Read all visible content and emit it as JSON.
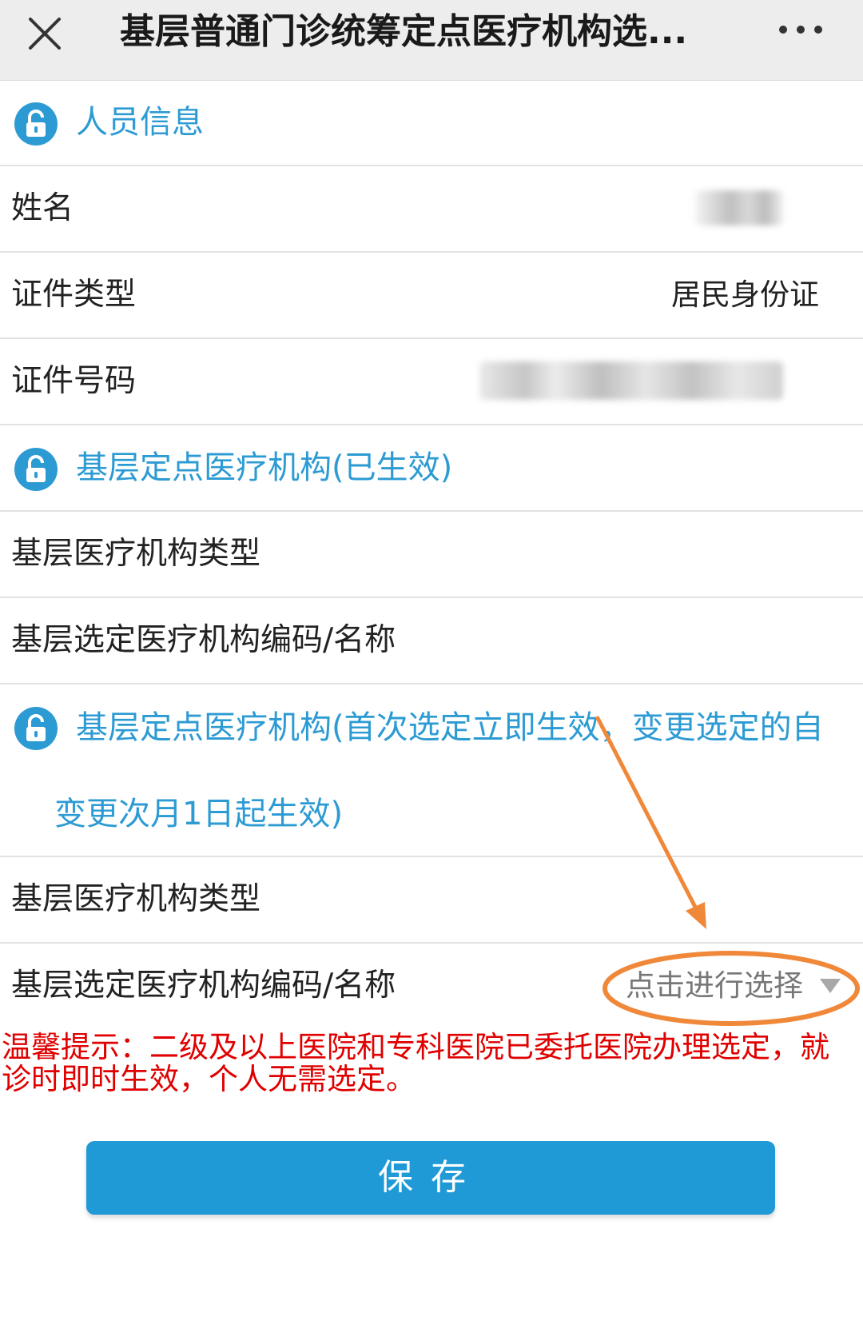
{
  "header": {
    "title": "基层普通门诊统筹定点医疗机构选...",
    "close_icon": "close-icon",
    "more_icon": "more-icon"
  },
  "sections": {
    "personal": {
      "title": "人员信息",
      "icon": "lock-icon",
      "name_label": "姓名",
      "id_type_label": "证件类型",
      "id_type_value": "居民身份证",
      "id_number_label": "证件号码"
    },
    "current": {
      "title": "基层定点医疗机构(已生效)",
      "icon": "lock-icon",
      "type_label": "基层医疗机构类型",
      "code_label": "基层选定医疗机构编码/名称"
    },
    "new_selection": {
      "title": "基层定点医疗机构(首次选定立即生效，变更选定的自变更次月1日起生效)",
      "icon": "lock-icon",
      "type_label": "基层医疗机构类型",
      "code_label": "基层选定医疗机构编码/名称",
      "select_value": "点击进行选择"
    }
  },
  "tip": "温馨提示：二级及以上医院和专科医院已委托医院办理选定，就诊时即时生效，个人无需选定。",
  "save_label": "保存",
  "colors": {
    "accent": "#2d9bd3",
    "save_button": "#1f9ad6",
    "tip": "#e00000",
    "annotation": "#f0883a"
  }
}
